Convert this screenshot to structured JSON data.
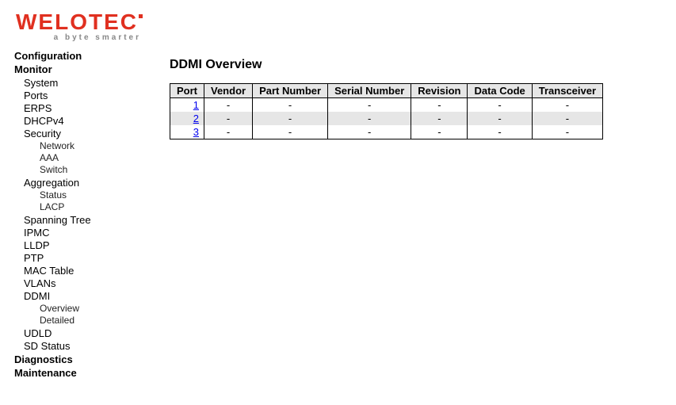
{
  "logo": {
    "main": "WELOTEC",
    "tagline": "a byte smarter"
  },
  "sidebar": {
    "top_items": {
      "configuration": "Configuration",
      "monitor": "Monitor",
      "diagnostics": "Diagnostics",
      "maintenance": "Maintenance"
    },
    "monitor_items": {
      "system": "System",
      "ports": "Ports",
      "erps": "ERPS",
      "dhcpv4": "DHCPv4",
      "security": "Security",
      "security_sub": {
        "network": "Network",
        "aaa": "AAA",
        "switch": "Switch"
      },
      "aggregation": "Aggregation",
      "aggregation_sub": {
        "status": "Status",
        "lacp": "LACP"
      },
      "spanning_tree": "Spanning Tree",
      "ipmc": "IPMC",
      "lldp": "LLDP",
      "ptp": "PTP",
      "mac_table": "MAC Table",
      "vlans": "VLANs",
      "ddmi": "DDMI",
      "ddmi_sub": {
        "overview": "Overview",
        "detailed": "Detailed"
      },
      "udld": "UDLD",
      "sd_status": "SD Status"
    }
  },
  "page": {
    "title": "DDMI Overview",
    "columns": {
      "port": "Port",
      "vendor": "Vendor",
      "part_number": "Part Number",
      "serial_number": "Serial Number",
      "revision": "Revision",
      "data_code": "Data Code",
      "transceiver": "Transceiver"
    },
    "rows": [
      {
        "port": "1",
        "vendor": "-",
        "part_number": "-",
        "serial_number": "-",
        "revision": "-",
        "data_code": "-",
        "transceiver": "-"
      },
      {
        "port": "2",
        "vendor": "-",
        "part_number": "-",
        "serial_number": "-",
        "revision": "-",
        "data_code": "-",
        "transceiver": "-"
      },
      {
        "port": "3",
        "vendor": "-",
        "part_number": "-",
        "serial_number": "-",
        "revision": "-",
        "data_code": "-",
        "transceiver": "-"
      }
    ]
  }
}
